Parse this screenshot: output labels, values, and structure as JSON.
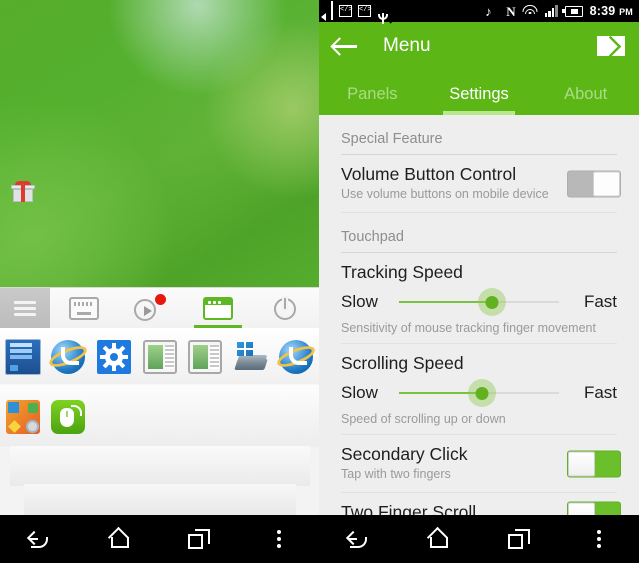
{
  "left_phone": {
    "desktop": {
      "icons": [
        {
          "name": "gift-box-shortcut",
          "label": ""
        }
      ]
    },
    "taskbar": {
      "menu_icon": "hamburger-menu-icon",
      "items": [
        {
          "icon": "keyboard-icon",
          "selected": false
        },
        {
          "icon": "play-record-icon",
          "selected": false,
          "badge": true
        },
        {
          "icon": "window-icon",
          "selected": true
        },
        {
          "icon": "power-icon",
          "selected": false
        }
      ]
    },
    "dock": {
      "row1": [
        {
          "icon": "windows-desktop-icon"
        },
        {
          "icon": "internet-explorer-icon"
        },
        {
          "icon": "settings-gear-icon"
        },
        {
          "icon": "document-window-icon"
        },
        {
          "icon": "document-window-icon"
        },
        {
          "icon": "windows-drive-icon"
        },
        {
          "icon": "internet-explorer-icon"
        }
      ],
      "row2": [
        {
          "icon": "accessories-search-icon"
        },
        {
          "icon": "green-mouse-remote-icon"
        }
      ]
    },
    "navbar": {
      "back": "back-icon",
      "home": "home-icon",
      "recents": "recents-icon",
      "more": "more-vert-icon"
    }
  },
  "right_phone": {
    "statusbar": {
      "icons_left": [
        "tag-plus-icon",
        "sd-card-icon",
        "code-icon",
        "code-icon",
        "usb-icon",
        "mail-icon"
      ],
      "icons_right": [
        "mute-icon",
        "nfc-icon",
        "wifi-icon",
        "signal-icon",
        "battery-charging-icon"
      ],
      "code_glyph": "</>",
      "nfc_glyph": "N",
      "mute_glyph": "♪",
      "time": "8:39",
      "time_suffix": "PM"
    },
    "appbar": {
      "back_icon": "back-arrow-icon",
      "title": "Menu",
      "action_icon": "mail-icon"
    },
    "tabs": [
      {
        "label": "Panels",
        "active": false
      },
      {
        "label": "Settings",
        "active": true
      },
      {
        "label": "About",
        "active": false
      }
    ],
    "sections": [
      {
        "header": "Special Feature",
        "rows": [
          {
            "type": "toggle",
            "title": "Volume Button Control",
            "subtitle": "Use volume buttons on mobile device",
            "state": "off"
          }
        ]
      },
      {
        "header": "Touchpad",
        "rows": [
          {
            "type": "slider",
            "title": "Tracking Speed",
            "min_label": "Slow",
            "max_label": "Fast",
            "value_pct": 58,
            "subtitle": "Sensitivity of mouse tracking finger movement"
          },
          {
            "type": "slider",
            "title": "Scrolling Speed",
            "min_label": "Slow",
            "max_label": "Fast",
            "value_pct": 52,
            "subtitle": "Speed of scrolling up or down"
          },
          {
            "type": "toggle",
            "title": "Secondary Click",
            "subtitle": "Tap with two fingers",
            "state": "on"
          },
          {
            "type": "toggle",
            "title": "Two Finger Scroll",
            "subtitle": "",
            "state": "on"
          }
        ]
      }
    ],
    "navbar": {
      "back": "back-icon",
      "home": "home-icon",
      "recents": "recents-icon",
      "more": "more-vert-icon"
    },
    "colors": {
      "accent": "#5cb615",
      "tab_indicator": "#b9e78f",
      "toggle_on": "#6bbf2a",
      "slider_fill": "#79c23f"
    }
  }
}
